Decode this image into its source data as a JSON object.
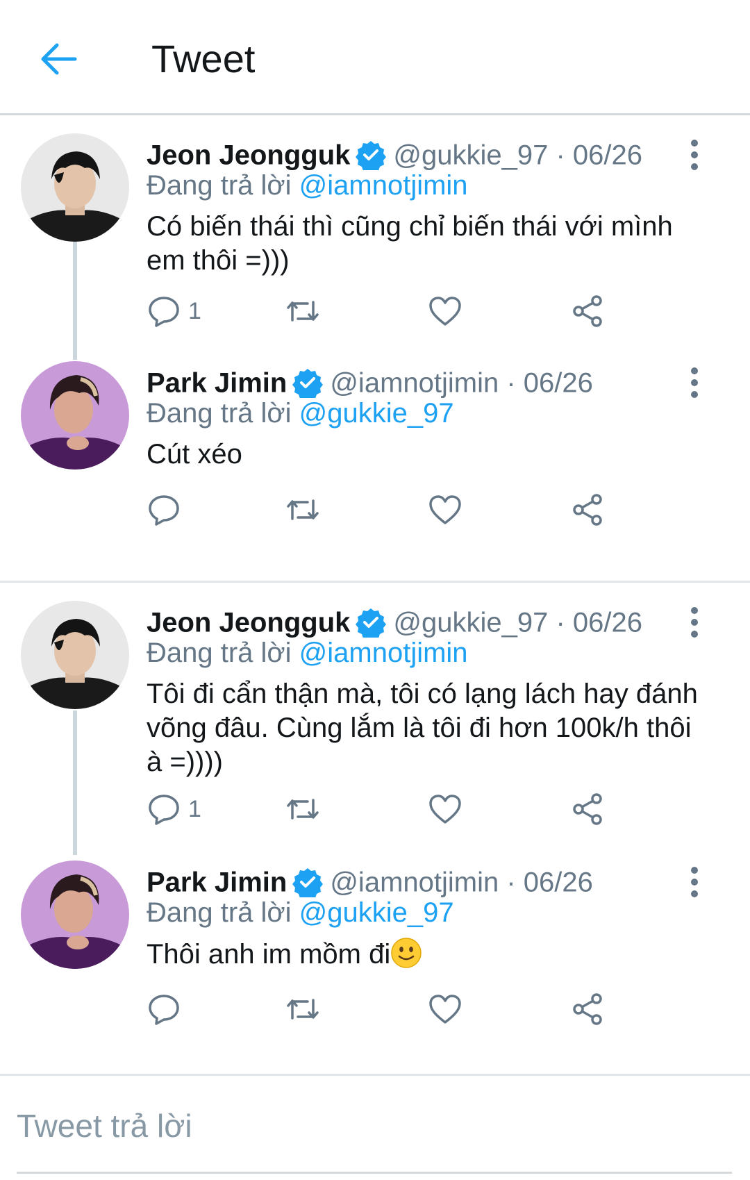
{
  "header": {
    "title": "Tweet",
    "back_icon": "arrow-left-icon"
  },
  "colors": {
    "accent": "#1da1f2",
    "secondary_text": "#657786",
    "primary_text": "#14171a",
    "divider": "#e1e6ea"
  },
  "threads": [
    {
      "tweets": [
        {
          "name": "Jeon Jeongguk",
          "handle": "@gukkie_97 · 06/26",
          "reply_prefix": "Đang trả lời ",
          "reply_mention": "@iamnotjimin",
          "text": "Có biến thái thì cũng chỉ biến thái với mình em thôi =)))",
          "reply_count": "1"
        },
        {
          "name": "Park Jimin",
          "handle": "@iamnotjimin · 06/26",
          "reply_prefix": "Đang trả lời ",
          "reply_mention": "@gukkie_97",
          "text": "Cút xéo",
          "reply_count": ""
        }
      ]
    },
    {
      "tweets": [
        {
          "name": "Jeon Jeongguk",
          "handle": "@gukkie_97 · 06/26",
          "reply_prefix": "Đang trả lời ",
          "reply_mention": "@iamnotjimin",
          "text": "Tôi đi cẩn thận mà, tôi có lạng lách hay đánh võng đâu. Cùng lắm là tôi đi hơn 100k/h thôi à =))))",
          "reply_count": "1"
        },
        {
          "name": "Park Jimin",
          "handle": "@iamnotjimin · 06/26",
          "reply_prefix": "Đang trả lời ",
          "reply_mention": "@gukkie_97",
          "text": "Thôi anh im mồm đi",
          "emoji": "slightly-smiling-face-emoji",
          "reply_count": ""
        }
      ]
    }
  ],
  "reply_bar": {
    "placeholder": "Tweet trả lời"
  }
}
